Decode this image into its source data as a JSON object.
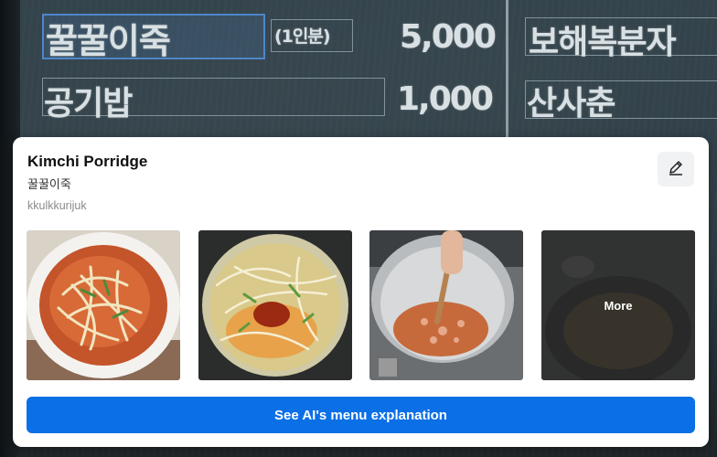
{
  "board": {
    "items": [
      {
        "name": "꿀꿀이죽",
        "portion": "(1인분)",
        "price": "5,000"
      },
      {
        "name": "공기밥",
        "price": "1,000"
      }
    ],
    "right_items": [
      "보해복분자",
      "산사춘"
    ]
  },
  "card": {
    "title": "Kimchi Porridge",
    "subtitle": "꿀꿀이죽",
    "romanized": "kkulkkurijuk",
    "edit_icon": "pencil-icon",
    "photos": [
      {
        "kind": "kimchi-porridge-bowl"
      },
      {
        "kind": "kimchi-porridge-pot"
      },
      {
        "kind": "cooking-pot-stirring"
      },
      {
        "kind": "more-photos",
        "label": "More"
      }
    ],
    "cta_label": "See AI's menu explanation"
  },
  "colors": {
    "accent": "#0b6fe6",
    "selection": "#4f86c9",
    "board": "#2f3f47"
  }
}
